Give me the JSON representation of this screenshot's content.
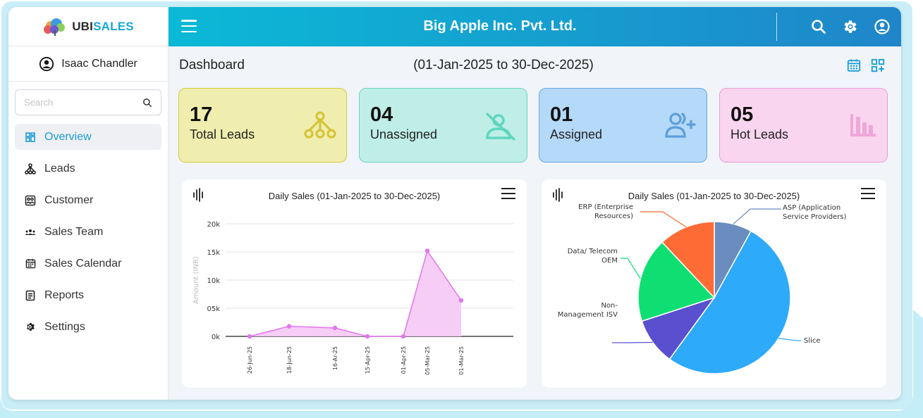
{
  "app": {
    "logo_prefix": "UBI",
    "logo_suffix": "SALES",
    "company": "Big Apple Inc. Pvt. Ltd."
  },
  "user": {
    "name": "Isaac Chandler"
  },
  "search": {
    "placeholder": "Search"
  },
  "sidebar": {
    "items": [
      {
        "label": "Overview",
        "icon": "grid-icon",
        "active": true
      },
      {
        "label": "Leads",
        "icon": "hierarchy-icon"
      },
      {
        "label": "Customer",
        "icon": "customer-icon"
      },
      {
        "label": "Sales Team",
        "icon": "team-icon"
      },
      {
        "label": "Sales Calendar",
        "icon": "calendar-icon"
      },
      {
        "label": "Reports",
        "icon": "report-icon"
      },
      {
        "label": "Settings",
        "icon": "gear-icon"
      }
    ]
  },
  "dashboard": {
    "title": "Dashboard",
    "date_range": "(01-Jan-2025 to 30-Dec-2025)"
  },
  "cards": [
    {
      "value": "17",
      "label": "Total Leads",
      "color": "#efeeae",
      "icon": "hierarchy-icon"
    },
    {
      "value": "04",
      "label": "Unassigned",
      "color": "#bfeee6",
      "icon": "user-off-icon"
    },
    {
      "value": "01",
      "label": "Assigned",
      "color": "#b5d9f8",
      "icon": "user-add-icon"
    },
    {
      "value": "05",
      "label": "Hot Leads",
      "color": "#fad5ef",
      "icon": "bar-chart-icon"
    }
  ],
  "colors": {
    "accent": "#18a7d6",
    "header_start": "#0bb9d6",
    "header_end": "#1f86c9"
  },
  "chart_data": [
    {
      "type": "area",
      "title": "Daily Sales (01-Jan-2025 to 30-Dec-2025)",
      "ylabel": "Amount (INR)",
      "xlabel": "",
      "categories": [
        "26-Jun-25",
        "18-Jun-25",
        "16-Ar-25",
        "15-Apr-25",
        "01-Apr-25",
        "05-Mar-25",
        "01-Mar-25"
      ],
      "values": [
        0,
        1800,
        1500,
        0,
        0,
        15200,
        6400
      ],
      "yticks": [
        "0k",
        "05k",
        "10k",
        "15k",
        "20k"
      ],
      "ylim": [
        0,
        20000
      ],
      "color": "#e176ee",
      "grid": true
    },
    {
      "type": "pie",
      "title": "Daily Sales (01-Jan-2025 to 30-Dec-2025)",
      "slices": [
        {
          "name": "ASP (Application Service Providers)",
          "value": 8,
          "color": "#6a8cbf"
        },
        {
          "name": "Slice",
          "value": 52,
          "color": "#2daaf9"
        },
        {
          "name": "Non-Management ISV",
          "value": 10,
          "color": "#5a4fcf"
        },
        {
          "name": "Data/ Telecom OEM",
          "value": 18,
          "color": "#0fdf72"
        },
        {
          "name": "ERP (Enterprise Resources)",
          "value": 12,
          "color": "#ff6b35"
        }
      ]
    }
  ]
}
